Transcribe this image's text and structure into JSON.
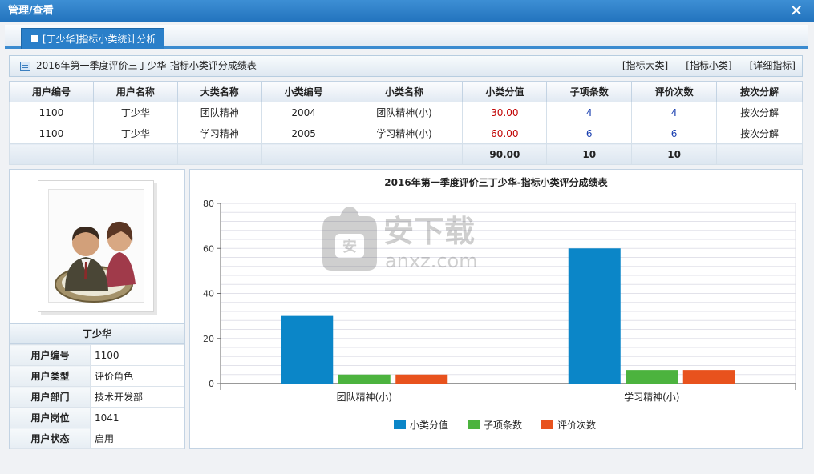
{
  "window": {
    "title": "管理/查看",
    "close_glyph": "✕"
  },
  "tab": {
    "label": "[丁少华]指标小类统计分析"
  },
  "toolbar": {
    "title": "2016年第一季度评价三丁少华-指标小类评分成绩表",
    "links": [
      "[指标大类]",
      "[指标小类]",
      "[详细指标]"
    ]
  },
  "table": {
    "headers": [
      "用户编号",
      "用户名称",
      "大类名称",
      "小类编号",
      "小类名称",
      "小类分值",
      "子项条数",
      "评价次数",
      "按次分解"
    ],
    "rows": [
      [
        "1100",
        "丁少华",
        "团队精神",
        "2004",
        "团队精神(小)",
        "30.00",
        "4",
        "4",
        "按次分解"
      ],
      [
        "1100",
        "丁少华",
        "学习精神",
        "2005",
        "学习精神(小)",
        "60.00",
        "6",
        "6",
        "按次分解"
      ]
    ],
    "totals": {
      "score": "90.00",
      "items": "10",
      "evals": "10"
    }
  },
  "profile": {
    "name": "丁少华",
    "fields": [
      {
        "key": "用户编号",
        "value": "1100"
      },
      {
        "key": "用户类型",
        "value": "评价角色"
      },
      {
        "key": "用户部门",
        "value": "技术开发部"
      },
      {
        "key": "用户岗位",
        "value": "1041"
      },
      {
        "key": "用户状态",
        "value": "启用"
      }
    ]
  },
  "watermark": {
    "brand": "安下载",
    "domain": "anxz.com"
  },
  "chart_data": {
    "type": "bar",
    "title": "2016年第一季度评价三丁少华-指标小类评分成绩表",
    "categories": [
      "团队精神(小)",
      "学习精神(小)"
    ],
    "series": [
      {
        "name": "小类分值",
        "values": [
          30,
          60
        ],
        "color": "#0b86c8"
      },
      {
        "name": "子项条数",
        "values": [
          4,
          6
        ],
        "color": "#4cb33e"
      },
      {
        "name": "评价次数",
        "values": [
          4,
          6
        ],
        "color": "#e8521d"
      }
    ],
    "ylim": [
      0,
      80
    ],
    "yticks": [
      0,
      20,
      40,
      60,
      80
    ],
    "grid": true,
    "legend": "bottom"
  }
}
